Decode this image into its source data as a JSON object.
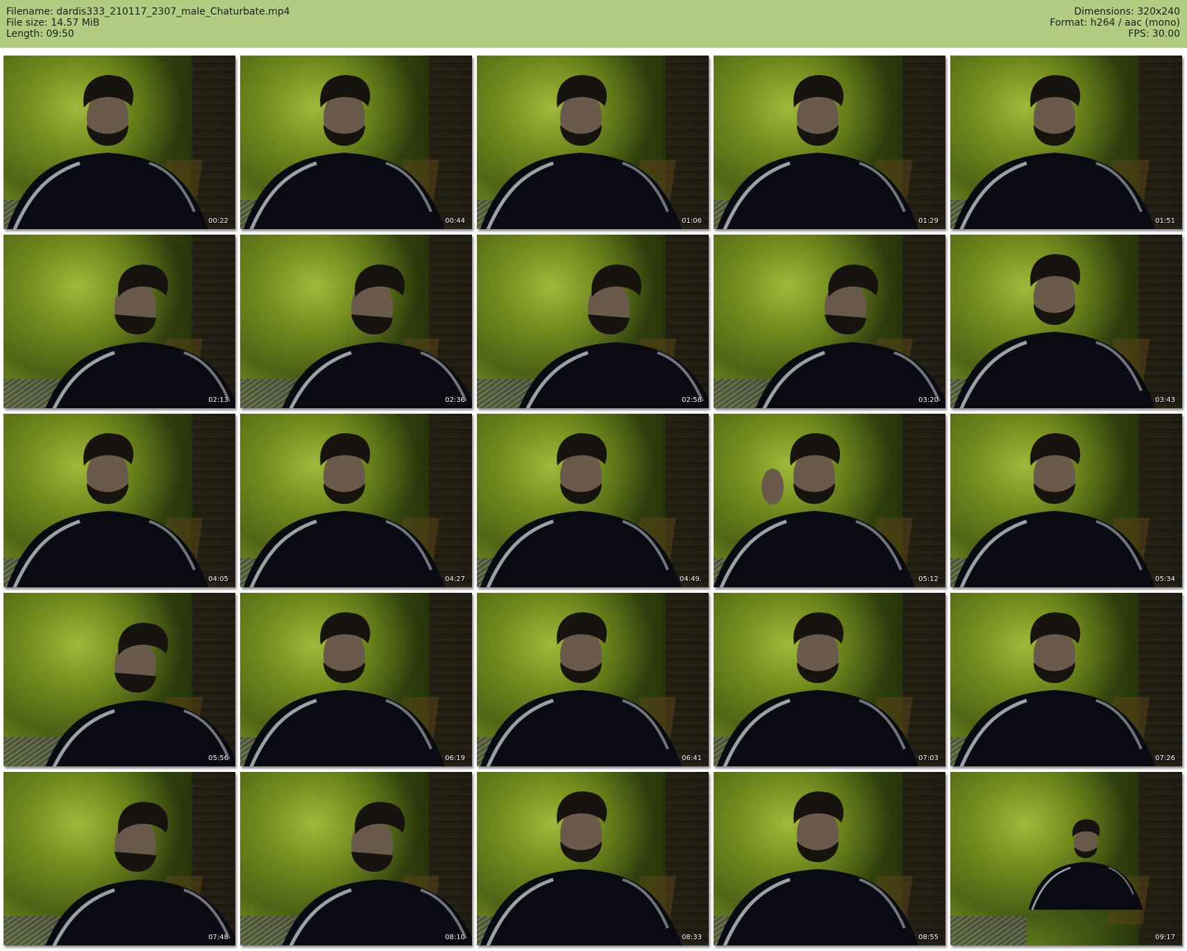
{
  "header": {
    "filename": "Filename: dardis333_210117_2307_male_Chaturbate.mp4",
    "file_size": "File size: 14.57 MiB",
    "length": "Length: 09:50",
    "dimensions": "Dimensions: 320x240",
    "format": "Format: h264 / aac (mono)",
    "fps": "FPS: 30.00"
  },
  "thumbnails": [
    {
      "time": "00:22",
      "pose": "front"
    },
    {
      "time": "00:44",
      "pose": "front"
    },
    {
      "time": "01:06",
      "pose": "front"
    },
    {
      "time": "01:29",
      "pose": "front"
    },
    {
      "time": "01:51",
      "pose": "front"
    },
    {
      "time": "02:13",
      "pose": "down"
    },
    {
      "time": "02:36",
      "pose": "down"
    },
    {
      "time": "02:58",
      "pose": "down"
    },
    {
      "time": "03:20",
      "pose": "down"
    },
    {
      "time": "03:43",
      "pose": "front"
    },
    {
      "time": "04:05",
      "pose": "front"
    },
    {
      "time": "04:27",
      "pose": "front"
    },
    {
      "time": "04:49.",
      "pose": "front"
    },
    {
      "time": "05:12",
      "pose": "hand"
    },
    {
      "time": "05:34",
      "pose": "front"
    },
    {
      "time": "05:56",
      "pose": "down"
    },
    {
      "time": "06:19",
      "pose": "front"
    },
    {
      "time": "06:41",
      "pose": "front"
    },
    {
      "time": "07:03",
      "pose": "front"
    },
    {
      "time": "07:26",
      "pose": "front"
    },
    {
      "time": "07:48",
      "pose": "down"
    },
    {
      "time": "08:10",
      "pose": "down"
    },
    {
      "time": "08:33",
      "pose": "front"
    },
    {
      "time": "08:55",
      "pose": "front"
    },
    {
      "time": "09:17",
      "pose": "far"
    }
  ],
  "colors": {
    "header_bg": "#b2cd82",
    "skin": "#6a5a4c",
    "hair": "#17130f",
    "jacket": "#0a0b12",
    "stripe": "#9aa2a6"
  }
}
